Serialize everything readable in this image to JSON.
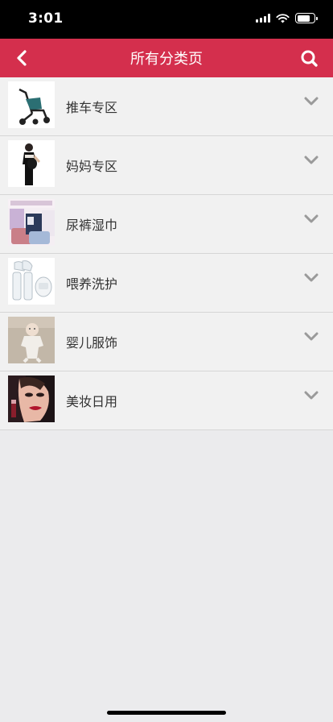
{
  "status_bar": {
    "time": "3:01"
  },
  "header": {
    "title": "所有分类页"
  },
  "categories": [
    {
      "label": "推车专区"
    },
    {
      "label": "妈妈专区"
    },
    {
      "label": "尿裤湿巾"
    },
    {
      "label": "喂养洗护"
    },
    {
      "label": "婴儿服饰"
    },
    {
      "label": "美妆日用"
    }
  ],
  "theme": {
    "accent": "#d42f4d",
    "background": "#ebebed",
    "row_background": "#f1f1f1"
  },
  "icons": {
    "back": "back-arrow-icon",
    "search": "search-icon",
    "expand": "chevron-down-icon"
  }
}
